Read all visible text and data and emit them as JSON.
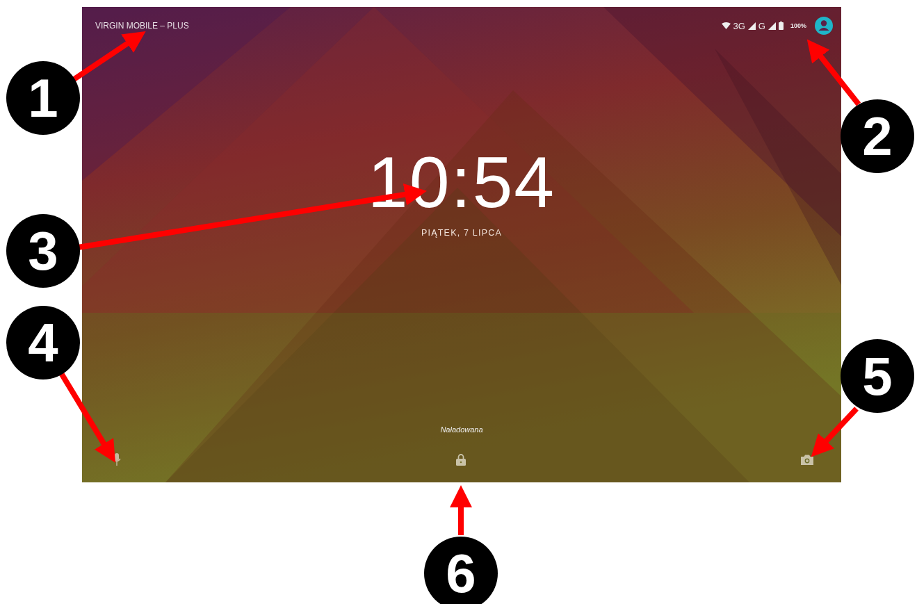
{
  "status_bar": {
    "carrier": "VIRGIN MOBILE – PLUS",
    "network_primary": "3G",
    "network_secondary": "G",
    "battery": "100%"
  },
  "clock": {
    "time": "10:54",
    "date": "PIĄTEK, 7 LIPCA"
  },
  "charging_status": "Naładowana",
  "callouts": [
    {
      "number": "1"
    },
    {
      "number": "2"
    },
    {
      "number": "3"
    },
    {
      "number": "4"
    },
    {
      "number": "5"
    },
    {
      "number": "6"
    }
  ]
}
